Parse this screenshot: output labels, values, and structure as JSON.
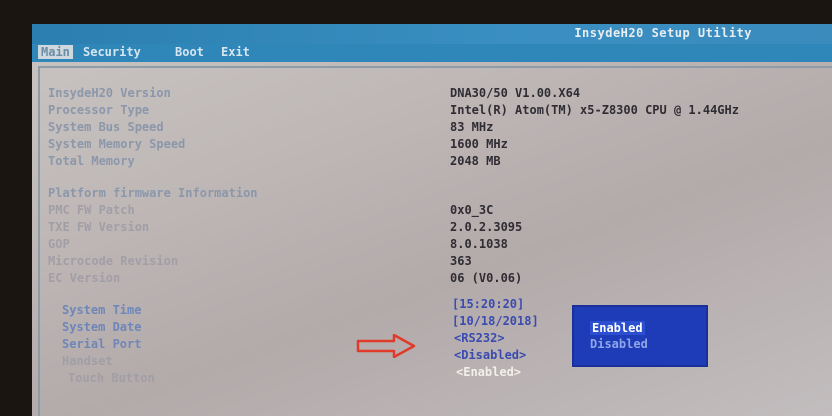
{
  "header": {
    "title": "InsydeH20 Setup Utility"
  },
  "menu": [
    {
      "label": "Main"
    },
    {
      "label": "Security"
    },
    {
      "label": "Boot"
    },
    {
      "label": "Exit"
    }
  ],
  "info": [
    {
      "label": "InsydeH20 Version",
      "value": "DNA30/50 V1.00.X64"
    },
    {
      "label": "Processor Type",
      "value": "Intel(R) Atom(TM) x5-Z8300  CPU @ 1.44GHz"
    },
    {
      "label": "System Bus Speed",
      "value": "83 MHz"
    },
    {
      "label": "System Memory Speed",
      "value": "1600 MHz"
    },
    {
      "label": "Total Memory",
      "value": "2048 MB"
    }
  ],
  "platform": {
    "heading": "Platform firmware Information",
    "items": [
      {
        "label": "PMC FW Patch",
        "value": "0x0_3C"
      },
      {
        "label": "TXE FW Version",
        "value": "2.0.2.3095"
      },
      {
        "label": "GOP",
        "value": "8.0.1038"
      },
      {
        "label": "Microcode Revision",
        "value": "363"
      },
      {
        "label": "EC Version",
        "value": "06 (V0.06)"
      }
    ]
  },
  "settings": [
    {
      "label": "System Time",
      "value": "[15:20:20]"
    },
    {
      "label": "System Date",
      "value": "[10/18/2018]"
    },
    {
      "label": "Serial Port",
      "value": "<RS232>"
    },
    {
      "label": "Handset",
      "value": "<Disabled>"
    },
    {
      "label": "Touch Button",
      "value": "<Enabled>"
    }
  ],
  "popup": {
    "options": [
      "Enabled",
      "Disabled"
    ],
    "selected": "Enabled"
  },
  "colors": {
    "menubar": "#2e86b9",
    "popup": "#1e3cb8",
    "arrow": "#e03a2a"
  }
}
